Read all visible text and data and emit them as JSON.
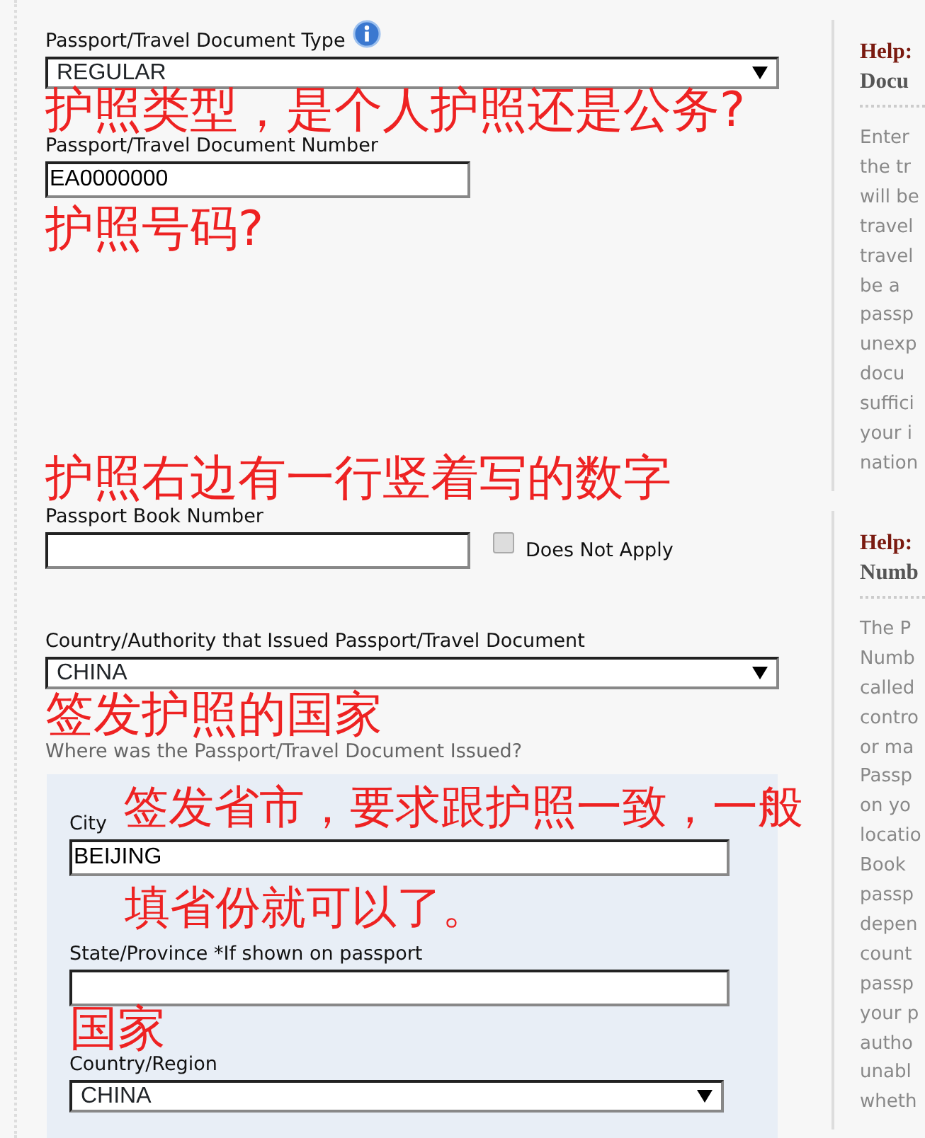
{
  "form": {
    "items": [
      {
        "kind": "select",
        "label": "Passport/Travel Document Type",
        "value": "REGULAR",
        "info_icon": true
      },
      {
        "kind": "note",
        "text": "护照类型，是个人护照还是公务?"
      },
      {
        "kind": "text",
        "label": "Passport/Travel Document Number",
        "value": "EA0000000"
      },
      {
        "kind": "note",
        "text": "护照号码?"
      },
      {
        "kind": "note",
        "text": "护照右边有一行竖着写的数字"
      },
      {
        "kind": "text_with_checkbox",
        "label": "Passport Book Number",
        "value": "",
        "checkbox_label": "Does Not Apply",
        "checked": false
      },
      {
        "kind": "select",
        "label": "Country/Authority that Issued Passport/Travel Document",
        "value": "CHINA"
      },
      {
        "kind": "note",
        "text": "签发护照的国家"
      }
    ]
  },
  "issue_location": {
    "prompt": "Where was the Passport/Travel Document Issued?",
    "overlay_note_lines": [
      "签发省市，要求跟护照一致，一般",
      "填省份就可以了。"
    ],
    "items": [
      {
        "kind": "text",
        "label": "City",
        "value": "BEIJING"
      },
      {
        "kind": "text",
        "label": "State/Province *If shown on passport",
        "value": ""
      },
      {
        "kind": "note",
        "text": "国家"
      },
      {
        "kind": "select",
        "label": "Country/Region",
        "value": "CHINA"
      }
    ]
  },
  "help_panels": [
    {
      "title_lines": [
        "Help:",
        "Docu"
      ],
      "body_lines": [
        "Enter",
        "the tr",
        "will be",
        "travel",
        "travel",
        "be a",
        "passp",
        "unexp",
        "docu",
        "suffici",
        "your i",
        "nation"
      ]
    },
    {
      "title_lines": [
        "Help:",
        "Numb"
      ],
      "body_lines": [
        "The P",
        "Numb",
        "called",
        "contro",
        "or ma",
        "Passp",
        "on yo",
        "locatio",
        "Book",
        "passp",
        "depen",
        "count",
        "passp",
        "your p",
        "autho",
        "unabl",
        "wheth"
      ]
    }
  ]
}
